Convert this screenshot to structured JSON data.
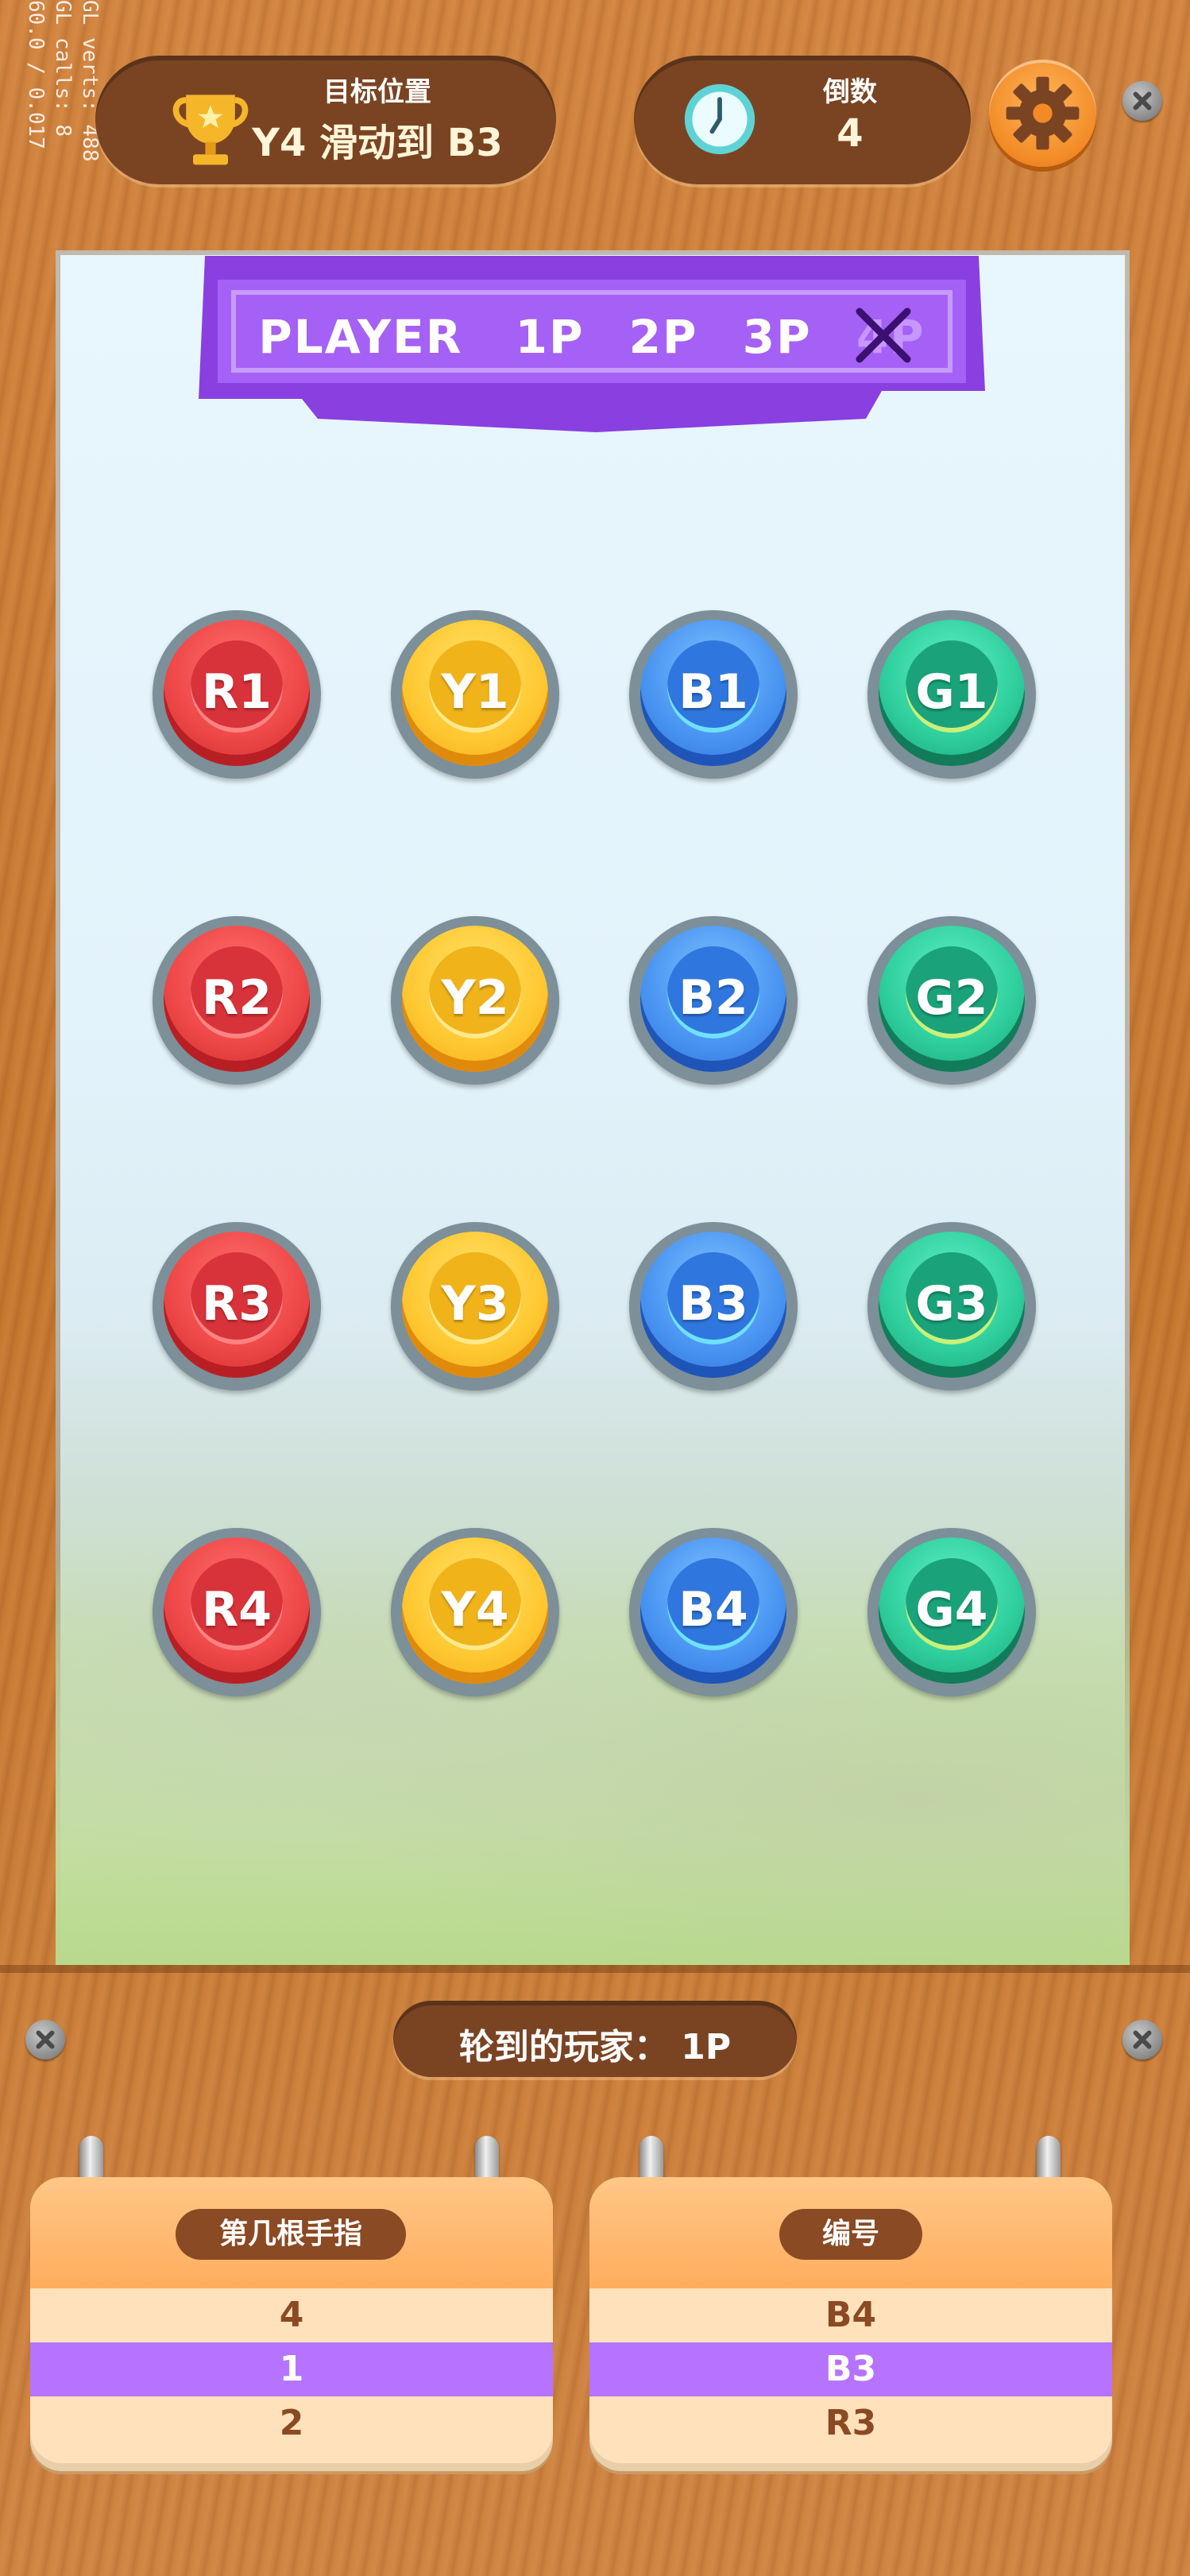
{
  "debug": {
    "line1": "GL verts:  488",
    "line2": "GL calls:  8",
    "line3": "60.0 / 0.017"
  },
  "goal": {
    "title": "目标位置",
    "value": "Y4 滑动到 B3"
  },
  "countdown": {
    "title": "倒数",
    "value": "4"
  },
  "player_banner": {
    "label": "PLAYER",
    "options": [
      "1P",
      "2P",
      "3P",
      "4P"
    ],
    "disabled_option": "4P"
  },
  "pieces": [
    [
      "R1",
      "Y1",
      "B1",
      "G1"
    ],
    [
      "R2",
      "Y2",
      "B2",
      "G2"
    ],
    [
      "R3",
      "Y3",
      "B3",
      "G3"
    ],
    [
      "R4",
      "Y4",
      "B4",
      "G4"
    ]
  ],
  "turn": {
    "text": "轮到的玩家：  1P"
  },
  "finger_picker": {
    "title": "第几根手指",
    "options": [
      "4",
      "1",
      "2"
    ],
    "selected": "1"
  },
  "number_picker": {
    "title": "编号",
    "options": [
      "B4",
      "B3",
      "R3"
    ],
    "selected": "B3"
  },
  "colors": {
    "accent_purple": "#b673ff",
    "wood": "#c5772f",
    "pill_brown": "#7a4423"
  }
}
